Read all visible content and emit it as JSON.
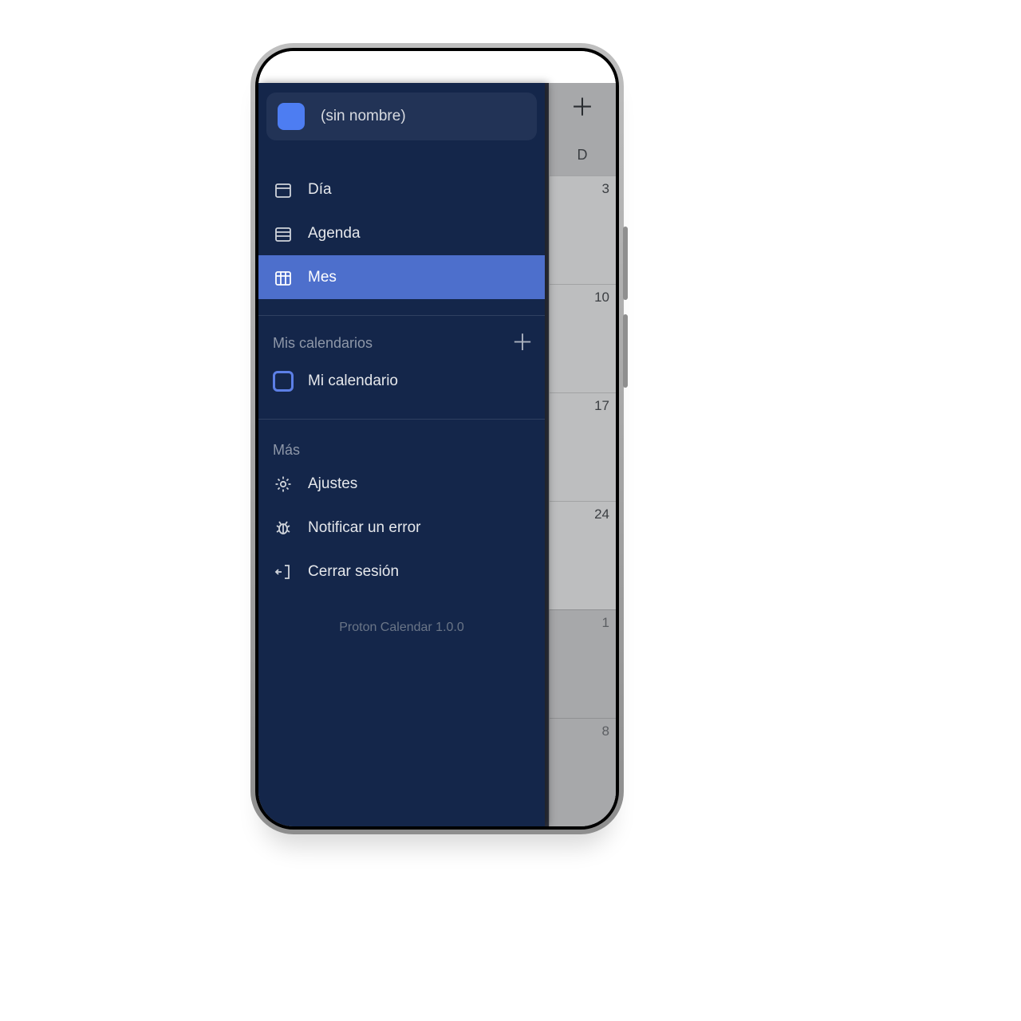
{
  "colors": {
    "drawer_bg": "#14264a",
    "pill_bg": "#223356",
    "accent": "#4d7df2",
    "selected": "#4d6fcc",
    "dim_bg": "#a7a8aa"
  },
  "profile": {
    "name": "(sin nombre)"
  },
  "views": {
    "day_label": "Día",
    "agenda_label": "Agenda",
    "month_label": "Mes",
    "selected": "month"
  },
  "calendars": {
    "header": "Mis calendarios",
    "items": [
      {
        "label": "Mi calendario",
        "checked": false,
        "color": "#5c7fe6"
      }
    ]
  },
  "more": {
    "header": "Más",
    "settings": "Ajustes",
    "report": "Notificar un error",
    "logout": "Cerrar sesión"
  },
  "footer_version": "Proton Calendar 1.0.0",
  "calendar_peek": {
    "day_header": "D",
    "cells": [
      "3",
      "10",
      "17",
      "24",
      "1",
      "8"
    ]
  }
}
